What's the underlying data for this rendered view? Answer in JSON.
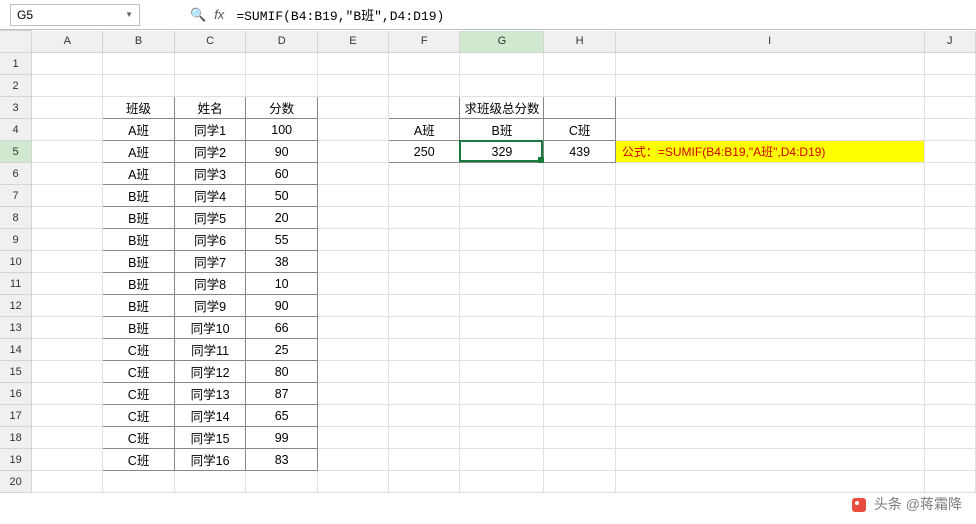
{
  "name_box": "G5",
  "formula": "=SUMIF(B4:B19,\"B班\",D4:D19)",
  "columns": [
    "A",
    "B",
    "C",
    "D",
    "E",
    "F",
    "G",
    "H",
    "I",
    "J"
  ],
  "row_count": 20,
  "active_cell": "G5",
  "headers": {
    "b3": "班级",
    "c3": "姓名",
    "d3": "分数"
  },
  "students": [
    {
      "row": 4,
      "class": "A班",
      "name": "同学1",
      "score": "100"
    },
    {
      "row": 5,
      "class": "A班",
      "name": "同学2",
      "score": "90"
    },
    {
      "row": 6,
      "class": "A班",
      "name": "同学3",
      "score": "60"
    },
    {
      "row": 7,
      "class": "B班",
      "name": "同学4",
      "score": "50"
    },
    {
      "row": 8,
      "class": "B班",
      "name": "同学5",
      "score": "20"
    },
    {
      "row": 9,
      "class": "B班",
      "name": "同学6",
      "score": "55"
    },
    {
      "row": 10,
      "class": "B班",
      "name": "同学7",
      "score": "38"
    },
    {
      "row": 11,
      "class": "B班",
      "name": "同学8",
      "score": "10"
    },
    {
      "row": 12,
      "class": "B班",
      "name": "同学9",
      "score": "90"
    },
    {
      "row": 13,
      "class": "B班",
      "name": "同学10",
      "score": "66"
    },
    {
      "row": 14,
      "class": "C班",
      "name": "同学11",
      "score": "25"
    },
    {
      "row": 15,
      "class": "C班",
      "name": "同学12",
      "score": "80"
    },
    {
      "row": 16,
      "class": "C班",
      "name": "同学13",
      "score": "87"
    },
    {
      "row": 17,
      "class": "C班",
      "name": "同学14",
      "score": "65"
    },
    {
      "row": 18,
      "class": "C班",
      "name": "同学15",
      "score": "99"
    },
    {
      "row": 19,
      "class": "C班",
      "name": "同学16",
      "score": "83"
    }
  ],
  "summary": {
    "title": "求班级总分数",
    "labels": {
      "f4": "A班",
      "g4": "B班",
      "h4": "C班"
    },
    "values": {
      "f5": "250",
      "g5": "329",
      "h5": "439"
    }
  },
  "note": "公式：=SUMIF(B4:B19,\"A班\",D4:D19)",
  "watermark": "头条 @蒋霜降"
}
